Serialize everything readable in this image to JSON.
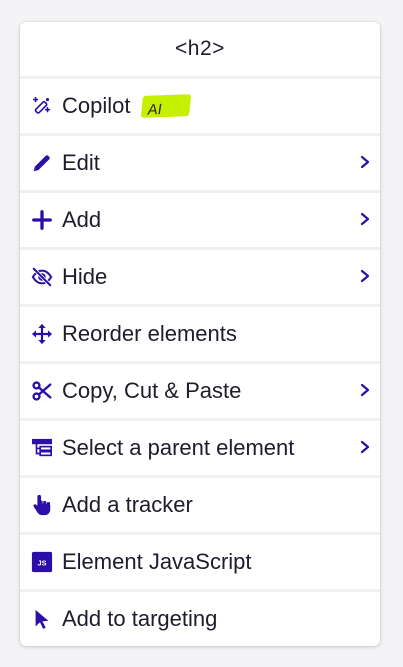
{
  "menu": {
    "title": "<h2>",
    "copilot": {
      "label": "Copilot",
      "badge": "AI"
    },
    "edit": {
      "label": "Edit"
    },
    "add": {
      "label": "Add"
    },
    "hide": {
      "label": "Hide"
    },
    "reorder": {
      "label": "Reorder elements"
    },
    "copy_cut_paste": {
      "label": "Copy, Cut & Paste"
    },
    "select_parent": {
      "label": "Select a parent element"
    },
    "add_tracker": {
      "label": "Add a tracker"
    },
    "element_js": {
      "label": "Element JavaScript",
      "icon_text": "JS"
    },
    "add_targeting": {
      "label": "Add to targeting"
    }
  },
  "colors": {
    "accent": "#2b0fa8",
    "badge": "#c6f000",
    "text": "#1d1d2b",
    "divider": "#f0f0f3"
  },
  "icons": [
    "sparkle-wand-icon",
    "pencil-icon",
    "plus-icon",
    "eye-slash-icon",
    "move-arrows-icon",
    "scissors-icon",
    "hierarchy-icon",
    "hand-pointer-icon",
    "js-icon",
    "cursor-arrow-icon",
    "chevron-right-icon"
  ]
}
